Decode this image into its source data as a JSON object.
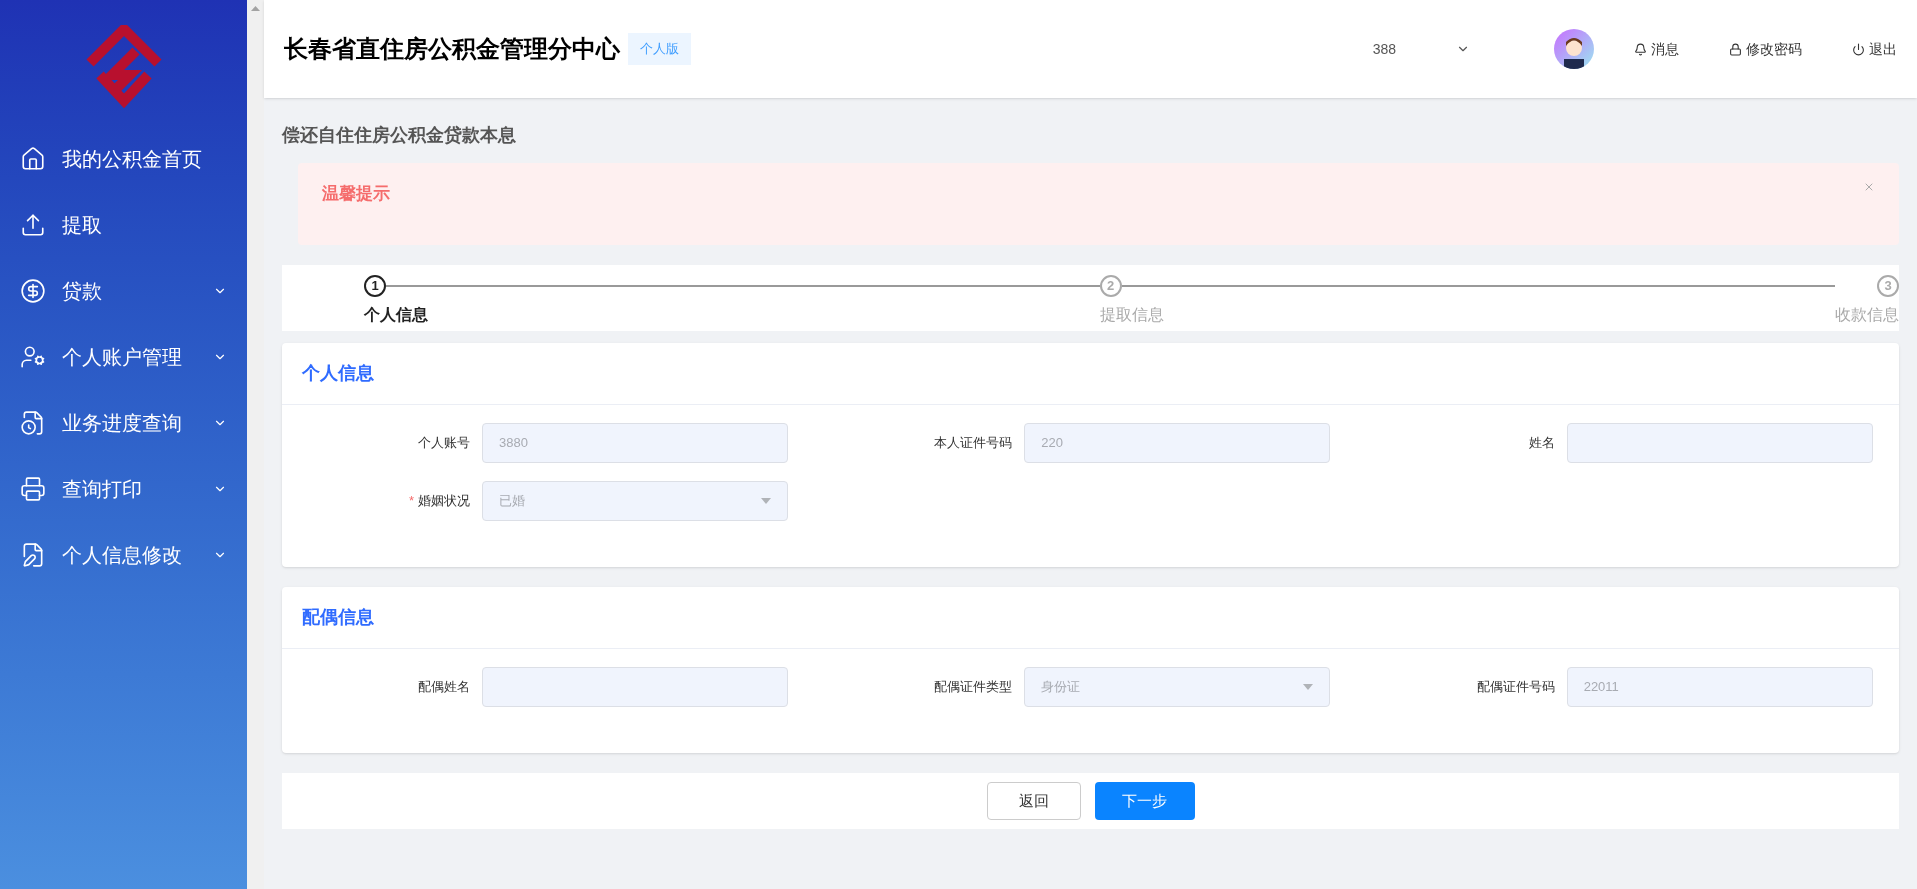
{
  "sidebar": {
    "items": [
      {
        "label": "我的公积金首页",
        "has_submenu": false
      },
      {
        "label": "提取",
        "has_submenu": false
      },
      {
        "label": "贷款",
        "has_submenu": true
      },
      {
        "label": "个人账户管理",
        "has_submenu": true
      },
      {
        "label": "业务进度查询",
        "has_submenu": true
      },
      {
        "label": "查询打印",
        "has_submenu": true
      },
      {
        "label": "个人信息修改",
        "has_submenu": true
      }
    ]
  },
  "header": {
    "title": "长春省直住房公积金管理分中心",
    "badge": "个人版",
    "account": "388",
    "actions": [
      "消息",
      "修改密码",
      "退出"
    ]
  },
  "page_title": "偿还自住住房公积金贷款本息",
  "alert": {
    "title": "温馨提示",
    "closable": true
  },
  "steps": [
    {
      "number": "1",
      "label": "个人信息",
      "active": true
    },
    {
      "number": "2",
      "label": "提取信息",
      "active": false
    },
    {
      "number": "3",
      "label": "收款信息",
      "active": false
    }
  ],
  "sections": [
    {
      "title": "个人信息",
      "fields": [
        {
          "label": "个人账号",
          "kind": "input",
          "value": "3880"
        },
        {
          "label": "本人证件号码",
          "kind": "input",
          "value": "220"
        },
        {
          "label": "姓名",
          "kind": "input"
        },
        {
          "label": "婚姻状况",
          "kind": "select",
          "value": "已婚",
          "required_mark": "*"
        }
      ]
    },
    {
      "title": "配偶信息",
      "fields": [
        {
          "label": "配偶姓名",
          "kind": "input"
        },
        {
          "label": "配偶证件类型",
          "kind": "select",
          "value": "身份证"
        },
        {
          "label": "配偶证件号码",
          "kind": "input",
          "value": "22011"
        }
      ]
    }
  ],
  "buttons": [
    {
      "label": "返回",
      "kind": "secondary"
    },
    {
      "label": "下一步",
      "kind": "primary"
    }
  ]
}
